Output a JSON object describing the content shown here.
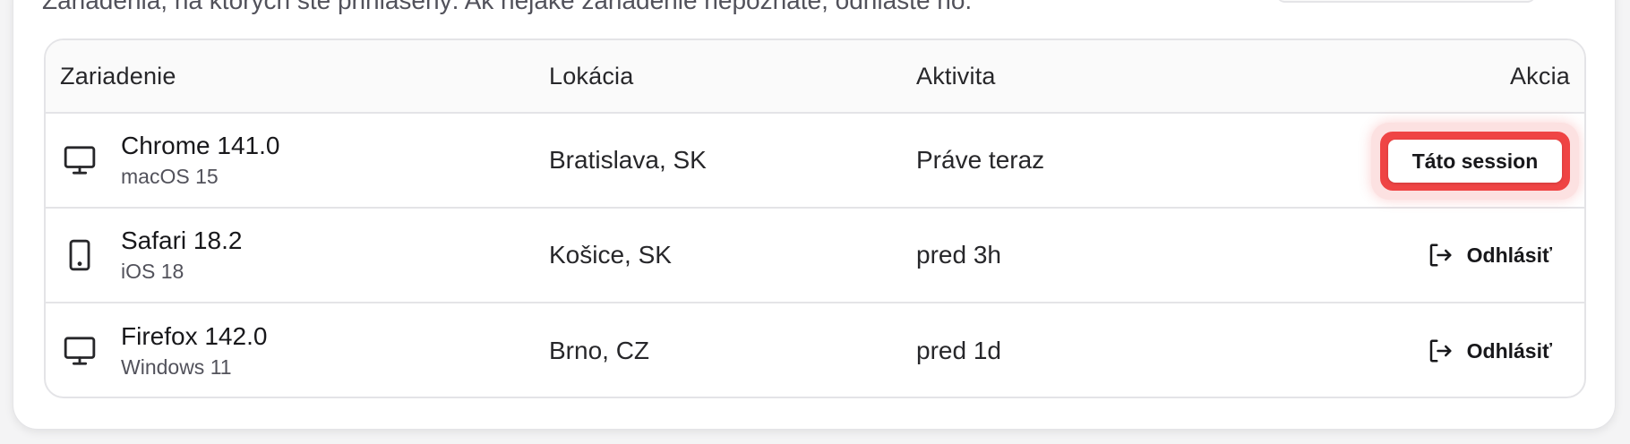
{
  "page": {
    "subtitle": "Zariadenia, na ktorých ste prihlásený. Ak nejaké zariadenie nepoznáte, odhláste ho."
  },
  "table": {
    "headers": {
      "device": "Zariadenie",
      "location": "Lokácia",
      "activity": "Aktivita",
      "action": "Akcia"
    },
    "rows": [
      {
        "icon": "monitor-icon",
        "browser": "Chrome 141.0",
        "os": "macOS 15",
        "location": "Bratislava, SK",
        "activity": "Práve teraz",
        "action": "Táto session"
      },
      {
        "icon": "tablet-icon",
        "browser": "Safari 18.2",
        "os": "iOS 18",
        "location": "Košice, SK",
        "activity": "pred 3h",
        "action": "Odhlásiť"
      },
      {
        "icon": "monitor-icon",
        "browser": "Firefox 142.0",
        "os": "Windows 11",
        "location": "Brno, CZ",
        "activity": "pred 1d",
        "action": "Odhlásiť"
      }
    ]
  },
  "colors": {
    "highlight": "#ef4444",
    "border": "#e4e4e7",
    "header_bg": "#fafafa"
  }
}
